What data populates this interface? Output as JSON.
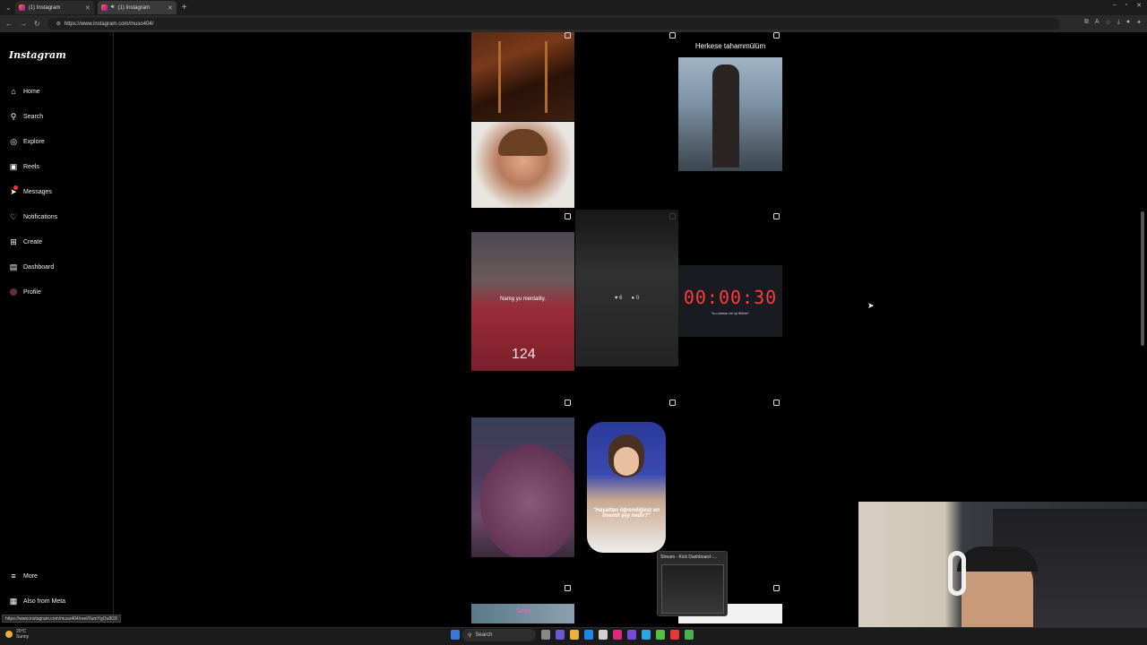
{
  "browser": {
    "tabs": [
      {
        "label": "(1) Instagram"
      },
      {
        "label": "(1) Instagram"
      }
    ],
    "new_tab": "+",
    "window_controls": [
      "–",
      "▫",
      "✕"
    ],
    "url": "https://www.instagram.com/muso404/",
    "status_url": "https://www.instagram.com/muso404/reel/0umYgOu803/"
  },
  "sidebar": {
    "logo": "Instagram",
    "items": [
      {
        "label": "Home",
        "icon": "home-icon"
      },
      {
        "label": "Search",
        "icon": "search-icon"
      },
      {
        "label": "Explore",
        "icon": "compass-icon"
      },
      {
        "label": "Reels",
        "icon": "reels-icon"
      },
      {
        "label": "Messages",
        "icon": "messages-icon"
      },
      {
        "label": "Notifications",
        "icon": "heart-icon"
      },
      {
        "label": "Create",
        "icon": "plus-icon"
      },
      {
        "label": "Dashboard",
        "icon": "dashboard-icon"
      },
      {
        "label": "Profile",
        "icon": "avatar"
      }
    ],
    "bottom": [
      {
        "label": "More",
        "icon": "menu-icon"
      },
      {
        "label": "Also from Meta",
        "icon": "meta-icon"
      }
    ]
  },
  "posts": {
    "top_right_caption": "Herkese tahammülüm",
    "red_shirt_caption": "Namg yu mentality.",
    "hover_stats": {
      "likes": "6",
      "comments": "0"
    },
    "timer_text": "00:00:30",
    "timer_sub": "\"bu zaman en iyi fikirler\"",
    "girl_caption": "\"Hayattan öğrendiğiniz en önemli şey nedir?\"",
    "song_caption": "Song"
  },
  "popup": {
    "title": "Stream - Kick Dashboard -..."
  },
  "taskbar": {
    "weather_temp": "20°C",
    "weather_desc": "Sunny",
    "search_label": "Search"
  },
  "colors": {
    "accent_badge": "#ff3040",
    "timer_red": "#ff3b3b"
  }
}
